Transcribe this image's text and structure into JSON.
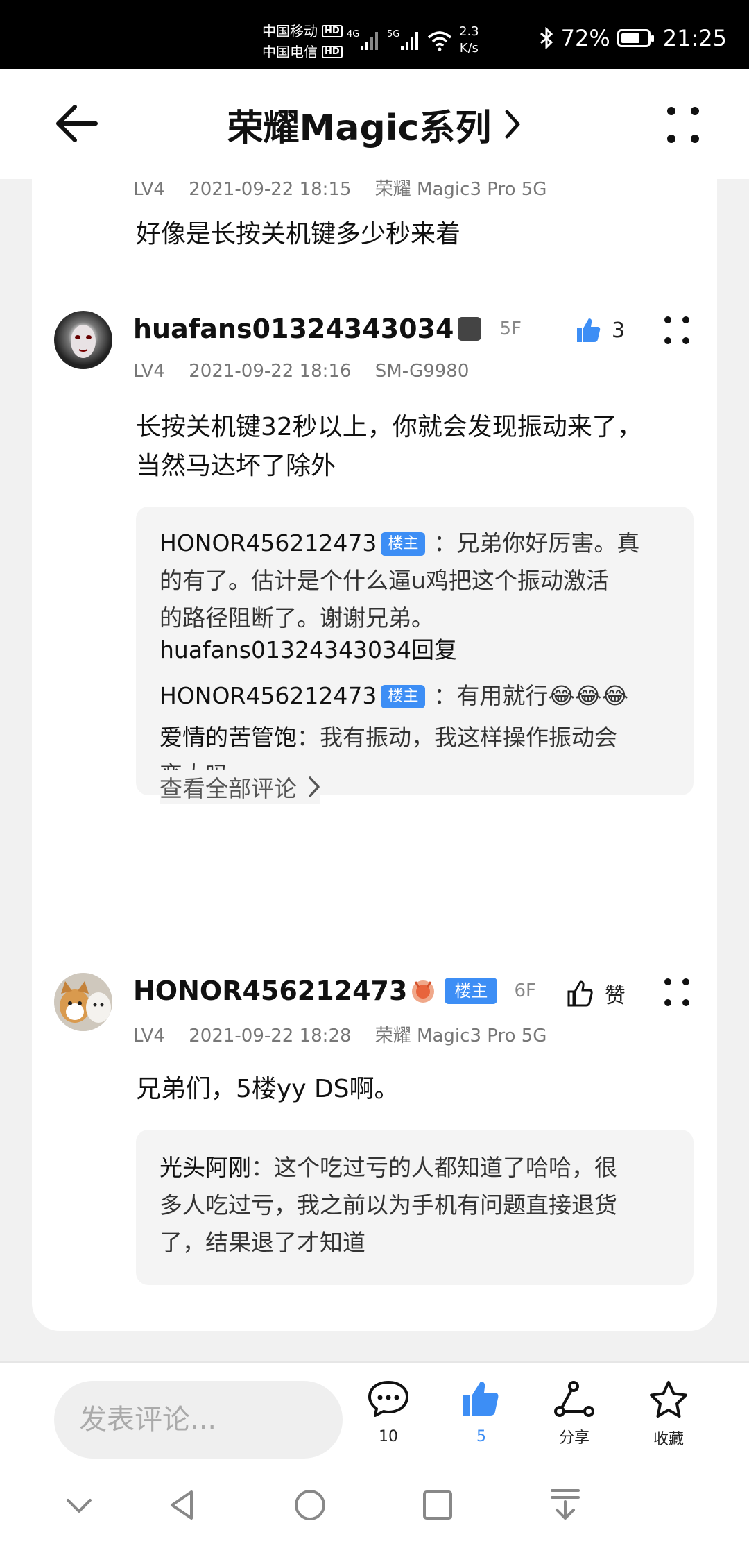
{
  "status_bar": {
    "carrier1": "中国移动",
    "carrier2": "中国电信",
    "hd": "HD",
    "sig1": "4G",
    "sig2": "5G",
    "speed_value": "2.3",
    "speed_unit": "K/s",
    "battery_percent": "72%",
    "battery_level": 0.72,
    "time": "21:25"
  },
  "header": {
    "title": "荣耀Magic系列",
    "icons": [
      "back-arrow-icon",
      "chevron-right-icon",
      "more-dots-icon"
    ]
  },
  "posts": [
    {
      "meta": {
        "level": "LV4",
        "datetime": "2021-09-22 18:15",
        "device": "荣耀 Magic3 Pro 5G"
      },
      "content": "好像是长按关机键多少秒来着"
    },
    {
      "username": "huafans01324343034",
      "floor": "5F",
      "like_count": "3",
      "meta": {
        "level": "LV4",
        "datetime": "2021-09-22 18:16",
        "device": "SM-G9980"
      },
      "content_line1": "长按关机键32秒以上，你就会发现振动来了，",
      "content_line2": "当然马达坏了除外",
      "replies": {
        "r1_name": "HONOR456212473",
        "r1_badge": "楼主",
        "r1_line1": "：兄弟你好厉害。真",
        "r1_line2": "的有了。估计是个什么逼u鸡把这个振动激活",
        "r1_line3": "的路径阻断了。谢谢兄弟。",
        "r2_prefix": "huafans01324343034回复",
        "r2_name": "HONOR456212473",
        "r2_badge": "楼主",
        "r2_text": "：有用就行😂😂😂",
        "r3_name": "爱情的苦管饱",
        "r3_line1": "：我有振动，我这样操作振动会",
        "r3_line2": "变大吗",
        "view_all": "查看全部评论"
      }
    },
    {
      "username": "HONOR456212473",
      "badge": "楼主",
      "floor": "6F",
      "like_label": "赞",
      "meta": {
        "level": "LV4",
        "datetime": "2021-09-22 18:28",
        "device": "荣耀 Magic3 Pro 5G"
      },
      "content": "兄弟们，5楼yy DS啊。",
      "replies": {
        "r1_name": "光头阿刚",
        "r1_line1": "：这个吃过亏的人都知道了哈哈，很",
        "r1_line2": "多人吃过亏，我之前以为手机有问题直接退货",
        "r1_line3": "了，结果退了才知道"
      }
    }
  ],
  "bottom_bar": {
    "comment_placeholder": "发表评论...",
    "comment_count": "10",
    "like_count": "5",
    "share_label": "分享",
    "favorite_label": "收藏",
    "accent_color": "#3d8ef5"
  }
}
